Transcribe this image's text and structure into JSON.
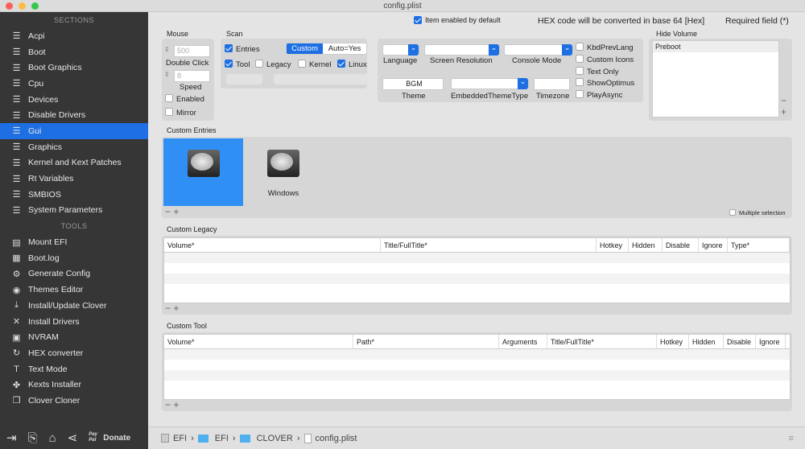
{
  "window": {
    "title": "config.plist"
  },
  "sidebar": {
    "sections_header": "SECTIONS",
    "sections": [
      {
        "label": "Acpi",
        "icon": "list-icon"
      },
      {
        "label": "Boot",
        "icon": "list-icon"
      },
      {
        "label": "Boot Graphics",
        "icon": "list-icon"
      },
      {
        "label": "Cpu",
        "icon": "list-icon"
      },
      {
        "label": "Devices",
        "icon": "list-icon"
      },
      {
        "label": "Disable Drivers",
        "icon": "list-icon"
      },
      {
        "label": "Gui",
        "icon": "list-icon",
        "active": true
      },
      {
        "label": "Graphics",
        "icon": "list-icon"
      },
      {
        "label": "Kernel and Kext Patches",
        "icon": "list-icon"
      },
      {
        "label": "Rt Variables",
        "icon": "list-icon"
      },
      {
        "label": "SMBIOS",
        "icon": "list-icon"
      },
      {
        "label": "System Parameters",
        "icon": "list-icon"
      }
    ],
    "tools_header": "TOOLS",
    "tools": [
      {
        "label": "Mount EFI",
        "icon": "disk-icon"
      },
      {
        "label": "Boot.log",
        "icon": "log-icon"
      },
      {
        "label": "Generate Config",
        "icon": "gear-icon"
      },
      {
        "label": "Themes Editor",
        "icon": "palette-icon"
      },
      {
        "label": "Install/Update Clover",
        "icon": "download-icon"
      },
      {
        "label": "Install Drivers",
        "icon": "wrench-icon"
      },
      {
        "label": "NVRAM",
        "icon": "chip-icon"
      },
      {
        "label": "HEX converter",
        "icon": "refresh-icon"
      },
      {
        "label": "Text Mode",
        "icon": "text-icon"
      },
      {
        "label": "Kexts Installer",
        "icon": "puzzle-icon"
      },
      {
        "label": "Clover Cloner",
        "icon": "clone-icon"
      }
    ],
    "donate": "Donate",
    "paypal": "Pay Pal"
  },
  "header": {
    "item_enabled": "Item enabled by default",
    "hex_note": "HEX code will be converted in base 64 [Hex]",
    "required": "Required field (*)"
  },
  "mouse": {
    "title": "Mouse",
    "double_click_value": "500",
    "double_click_label": "Double Click",
    "speed_value": "8",
    "speed_label": "Speed",
    "enabled": "Enabled",
    "mirror": "Mirror"
  },
  "scan": {
    "title": "Scan",
    "entries": "Entries",
    "tool": "Tool",
    "legacy": "Legacy",
    "kernel": "Kernel",
    "linux": "Linux",
    "seg_custom": "Custom",
    "seg_auto": "Auto=Yes"
  },
  "gui": {
    "language": "Language",
    "screen_resolution": "Screen Resolution",
    "console_mode": "Console Mode",
    "theme_value": "BGM",
    "theme": "Theme",
    "embedded_theme_type": "EmbeddedThemeType",
    "timezone": "Timezone",
    "kbd_prev_lang": "KbdPrevLang",
    "custom_icons": "Custom Icons",
    "text_only": "Text Only",
    "show_optimus": "ShowOptimus",
    "play_async": "PlayAsync"
  },
  "hide_volume": {
    "title": "Hide Volume",
    "items": [
      "Preboot"
    ]
  },
  "custom_entries": {
    "title": "Custom Entries",
    "entries": [
      "",
      "Windows"
    ],
    "multiple_selection": "Multiple selection"
  },
  "custom_legacy": {
    "title": "Custom Legacy",
    "columns": [
      "Volume*",
      "Title/FullTitle*",
      "Hotkey",
      "Hidden",
      "Disable",
      "Ignore",
      "Type*"
    ]
  },
  "custom_tool": {
    "title": "Custom Tool",
    "columns": [
      "Volume*",
      "Path*",
      "Arguments",
      "Title/FullTitle*",
      "Hotkey",
      "Hidden",
      "Disable",
      "Ignore"
    ]
  },
  "breadcrumb": [
    "EFI",
    "EFI",
    "CLOVER",
    "config.plist"
  ]
}
